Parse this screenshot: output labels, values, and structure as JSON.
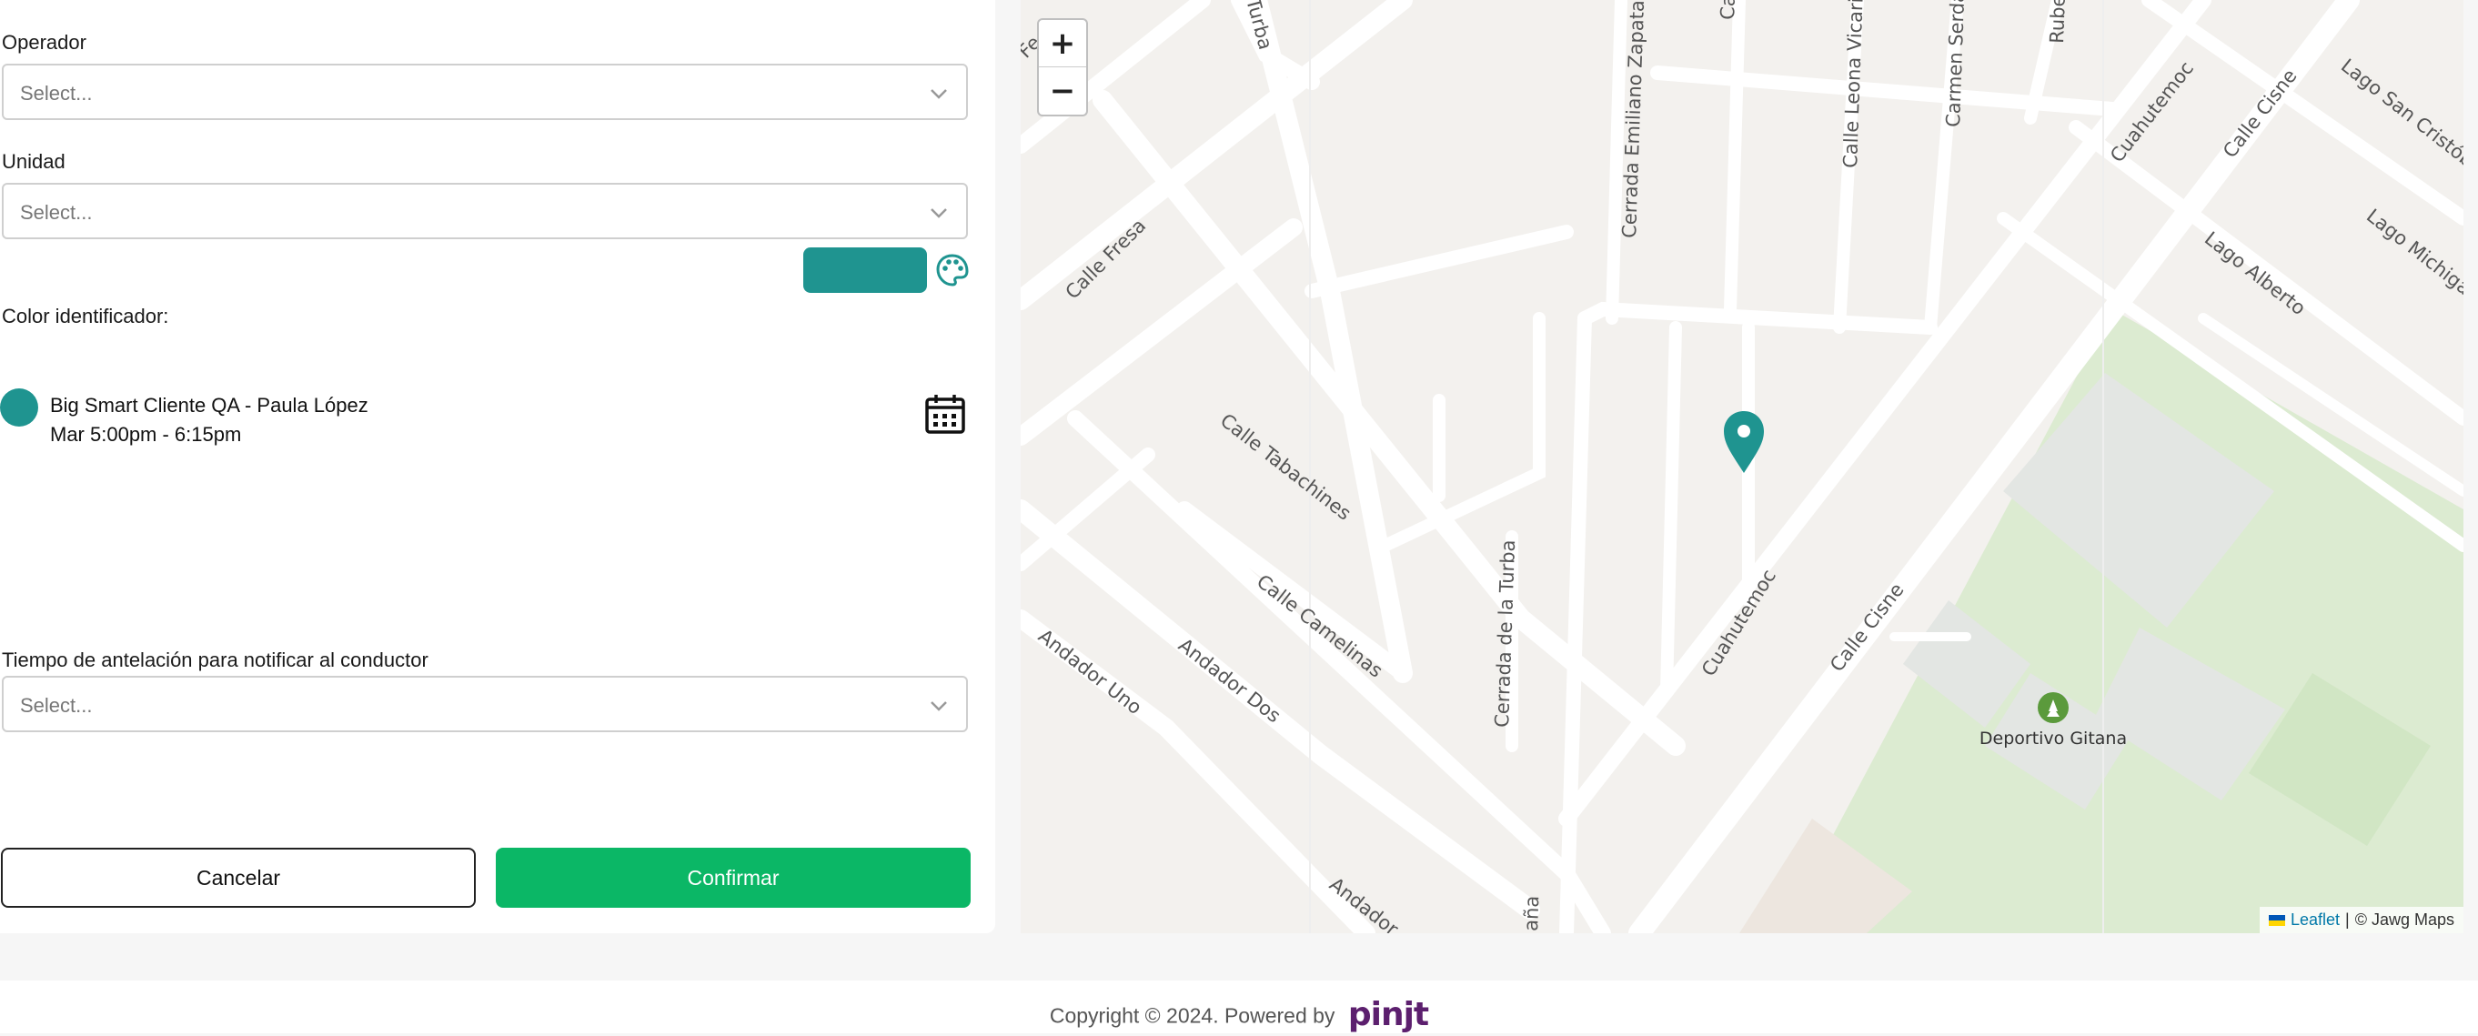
{
  "form": {
    "operator": {
      "label": "Operador",
      "placeholder": "Select..."
    },
    "unit": {
      "label": "Unidad",
      "placeholder": "Select..."
    },
    "color": {
      "label": "Color identificador:",
      "value": "#1f9490",
      "icon": "palette-icon"
    },
    "assignment": {
      "client": "Big Smart Cliente QA - Paula López",
      "schedule": "Mar 5:00pm - 6:15pm",
      "dot_color": "#1f9490",
      "icon": "calendar-icon"
    },
    "notice": {
      "label": "Tiempo de antelación para notificar al conductor",
      "placeholder": "Select..."
    },
    "cancel_label": "Cancelar",
    "confirm_label": "Confirmar"
  },
  "map": {
    "zoom_in": "+",
    "zoom_out": "−",
    "marker_color": "#1f9490",
    "streets": [
      "Calle Fresa",
      "Calle Tabachines",
      "Calle Camelinas",
      "Andador Uno",
      "Andador Dos",
      "Andador",
      "Cerrada de la Turba",
      "Cerrada Emiliano Zapata",
      "Calle Leona Vicario",
      "Carmen Serdán",
      "Cuahutemoc",
      "Calle Cisne",
      "Lago San Cristóbal",
      "Lago Alberto",
      "Lago Michigan",
      "Turba",
      "Ca",
      "Rube",
      "Fe",
      "aña"
    ],
    "poi": "Deportivo Gitana",
    "attribution": {
      "link": "Leaflet",
      "separator": " | ",
      "credit": "© Jawg Maps"
    }
  },
  "footer": {
    "copyright": "Copyright © 2024. Powered by",
    "brand": "pinjt"
  }
}
